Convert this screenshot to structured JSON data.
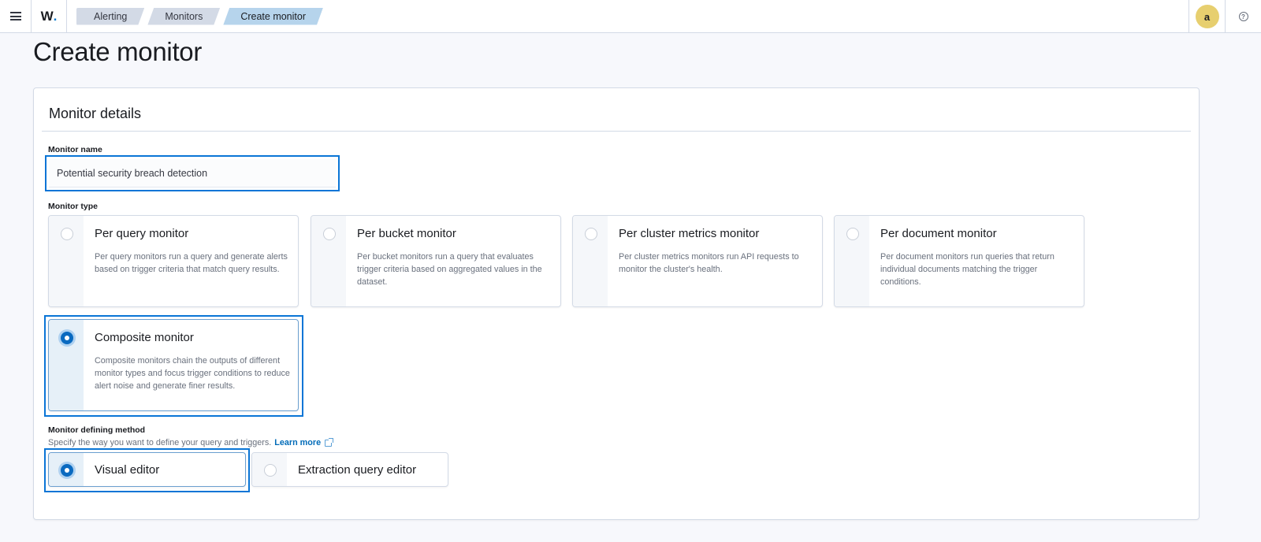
{
  "header": {
    "menu_icon": "hamburger-menu-icon",
    "logo_text": "W",
    "logo_dot": ".",
    "breadcrumbs": [
      "Alerting",
      "Monitors",
      "Create monitor"
    ],
    "avatar_initial": "a",
    "help_icon_glyph": "?"
  },
  "page": {
    "title": "Create monitor"
  },
  "panel": {
    "title": "Monitor details",
    "monitor_name": {
      "label": "Monitor name",
      "value": "Potential security breach detection"
    },
    "monitor_type": {
      "label": "Monitor type",
      "selected": "Composite monitor",
      "options": [
        {
          "title": "Per query monitor",
          "description": "Per query monitors run a query and generate alerts based on trigger criteria that match query results.",
          "checked": false
        },
        {
          "title": "Per bucket monitor",
          "description": "Per bucket monitors run a query that evaluates trigger criteria based on aggregated values in the dataset.",
          "checked": false
        },
        {
          "title": "Per cluster metrics monitor",
          "description": "Per cluster metrics monitors run API requests to monitor the cluster's health.",
          "checked": false
        },
        {
          "title": "Per document monitor",
          "description": "Per document monitors run queries that return individual documents matching the trigger conditions.",
          "checked": false
        },
        {
          "title": "Composite monitor",
          "description": "Composite monitors chain the outputs of different monitor types and focus trigger conditions to reduce alert noise and generate finer results.",
          "checked": true
        }
      ]
    },
    "defining_method": {
      "label": "Monitor defining method",
      "help_text": "Specify the way you want to define your query and triggers.",
      "learn_more": "Learn more",
      "selected": "Visual editor",
      "options": [
        {
          "title": "Visual editor",
          "checked": true
        },
        {
          "title": "Extraction query editor",
          "checked": false
        }
      ]
    }
  }
}
